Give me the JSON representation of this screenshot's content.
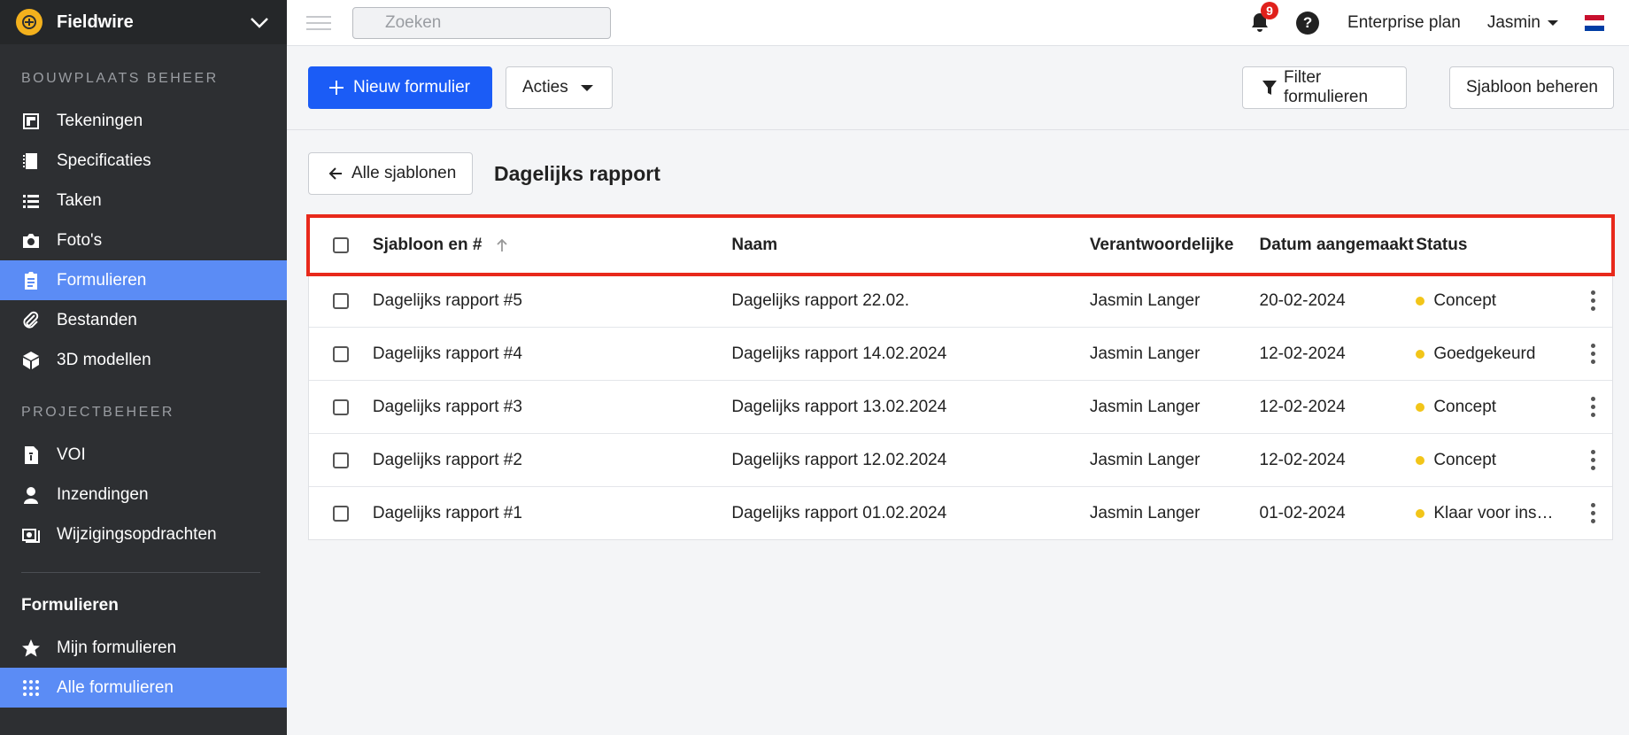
{
  "brand": {
    "name": "Fieldwire"
  },
  "sidebar": {
    "section1_title": "BOUWPLAATS BEHEER",
    "section1_items": [
      {
        "label": "Tekeningen",
        "icon": "drawings-icon"
      },
      {
        "label": "Specificaties",
        "icon": "specifications-icon"
      },
      {
        "label": "Taken",
        "icon": "tasks-icon"
      },
      {
        "label": "Foto's",
        "icon": "camera-icon"
      },
      {
        "label": "Formulieren",
        "icon": "forms-icon",
        "active": true
      },
      {
        "label": "Bestanden",
        "icon": "paperclip-icon"
      },
      {
        "label": "3D modellen",
        "icon": "cube-icon"
      }
    ],
    "section2_title": "PROJECTBEHEER",
    "section2_items": [
      {
        "label": "VOI",
        "icon": "document-icon"
      },
      {
        "label": "Inzendingen",
        "icon": "person-icon"
      },
      {
        "label": "Wijzigingsopdrachten",
        "icon": "change-order-icon"
      }
    ],
    "group_title": "Formulieren",
    "group_items": [
      {
        "label": "Mijn formulieren",
        "icon": "star-icon"
      },
      {
        "label": "Alle formulieren",
        "icon": "grid-icon",
        "active": true
      }
    ]
  },
  "topbar": {
    "search_placeholder": "Zoeken",
    "notification_count": "9",
    "help_label": "?",
    "plan": "Enterprise plan",
    "user": "Jasmin"
  },
  "toolbar": {
    "new_form": "Nieuw formulier",
    "actions": "Acties",
    "filter": "Filter formulieren",
    "manage_template": "Sjabloon beheren"
  },
  "content": {
    "back_label": "Alle sjablonen",
    "title": "Dagelijks rapport"
  },
  "table": {
    "headers": {
      "template": "Sjabloon en #",
      "name": "Naam",
      "responsible": "Verantwoordelijke",
      "date": "Datum aangemaakt",
      "status": "Status"
    },
    "rows": [
      {
        "template": "Dagelijks rapport #5",
        "name": "Dagelijks rapport 22.02.",
        "responsible": "Jasmin Langer",
        "date": "20-02-2024",
        "status": "Concept"
      },
      {
        "template": "Dagelijks rapport #4",
        "name": "Dagelijks rapport 14.02.2024",
        "responsible": "Jasmin Langer",
        "date": "12-02-2024",
        "status": "Goedgekeurd"
      },
      {
        "template": "Dagelijks rapport #3",
        "name": "Dagelijks rapport 13.02.2024",
        "responsible": "Jasmin Langer",
        "date": "12-02-2024",
        "status": "Concept"
      },
      {
        "template": "Dagelijks rapport #2",
        "name": "Dagelijks rapport 12.02.2024",
        "responsible": "Jasmin Langer",
        "date": "12-02-2024",
        "status": "Concept"
      },
      {
        "template": "Dagelijks rapport #1",
        "name": "Dagelijks rapport 01.02.2024",
        "responsible": "Jasmin Langer",
        "date": "01-02-2024",
        "status": "Klaar voor ins…"
      }
    ]
  },
  "colors": {
    "sidebar_bg": "#2d2f32",
    "active_nav": "#5b8cf5",
    "primary": "#1b5cf6",
    "status_dot": "#f2c519",
    "highlight": "#e8291b"
  }
}
